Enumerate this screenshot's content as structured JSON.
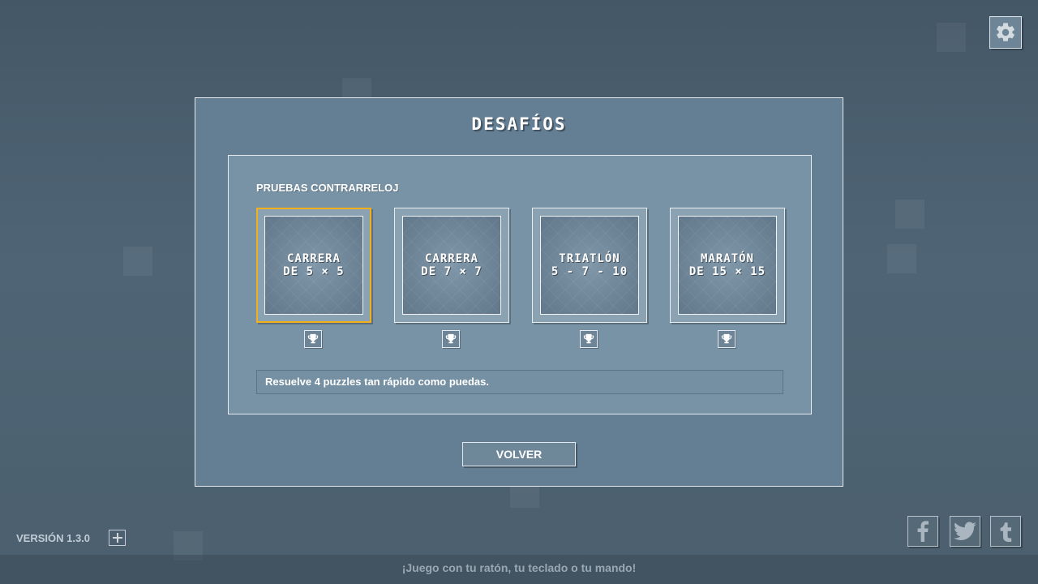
{
  "dialog": {
    "title": "DESAFÍOS",
    "section_title": "PRUEBAS CONTRARRELOJ",
    "challenges": [
      {
        "line1": "CARRERA",
        "line2": "DE 5 × 5",
        "selected": true,
        "trophy_icon": "trophy-icon"
      },
      {
        "line1": "CARRERA",
        "line2": "DE 7 × 7",
        "selected": false,
        "trophy_icon": "trophy-icon"
      },
      {
        "line1": "TRIATLÓN",
        "line2": "5 - 7 - 10",
        "selected": false,
        "trophy_icon": "trophy-icon"
      },
      {
        "line1": "MARATÓN",
        "line2": "DE 15 × 15",
        "selected": false,
        "trophy_icon": "trophy-icon"
      }
    ],
    "description": "Resuelve 4 puzzles tan rápido como puedas.",
    "back_label": "VOLVER"
  },
  "settings": {
    "icon": "gear-icon"
  },
  "version": {
    "label": "VERSIÓN 1.3.0",
    "expand_icon": "plus-icon"
  },
  "social": [
    {
      "name": "facebook",
      "icon": "facebook-icon"
    },
    {
      "name": "twitter",
      "icon": "twitter-icon"
    },
    {
      "name": "tumblr",
      "icon": "tumblr-icon"
    }
  ],
  "footer": {
    "text": "¡Juego con tu ratón, tu teclado o tu mando!"
  },
  "colors": {
    "dialog_bg": "#647f94",
    "panel_bg": "#7893a5",
    "selected_border": "#f2b01c",
    "page_bg": "#4b5f6e"
  }
}
